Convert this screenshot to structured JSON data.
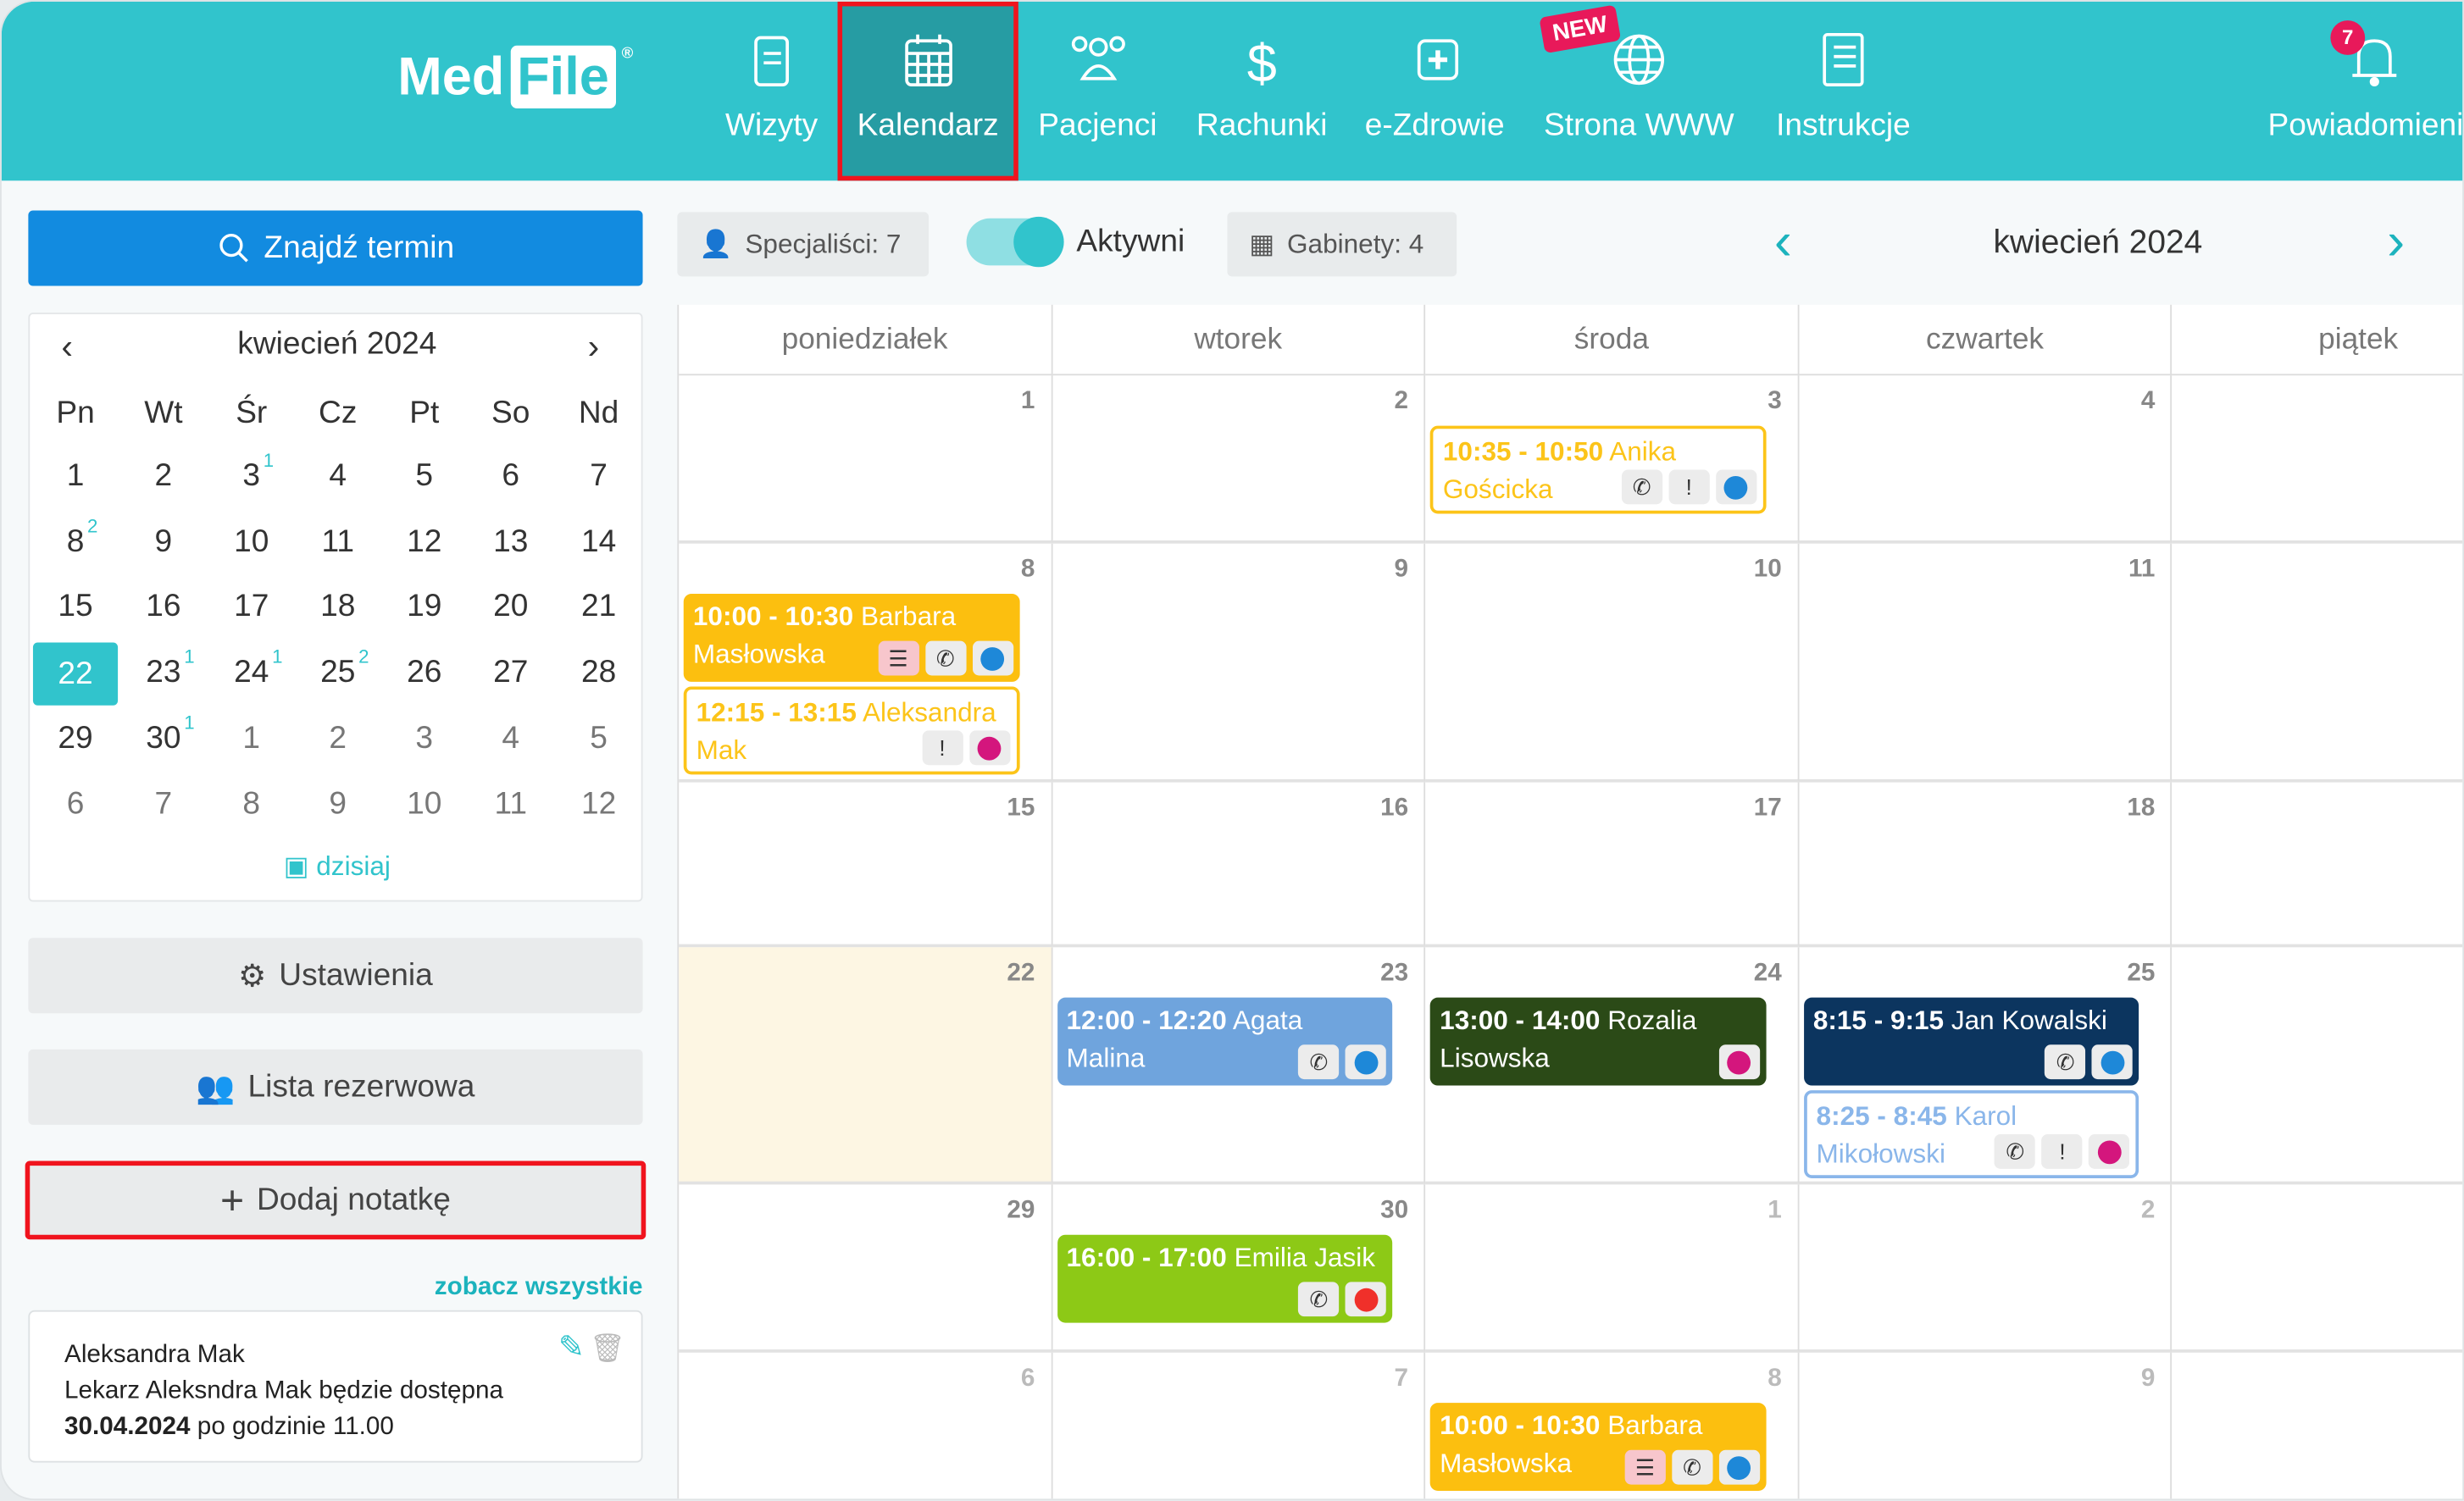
{
  "header": {
    "logo": {
      "text_a": "Med",
      "text_b": "File",
      "reg": "®"
    },
    "nav": [
      {
        "label": "Wizyty",
        "icon": "clipboard-icon",
        "active": false
      },
      {
        "label": "Kalendarz",
        "icon": "calendar-icon",
        "active": true
      },
      {
        "label": "Pacjenci",
        "icon": "users-icon",
        "active": false
      },
      {
        "label": "Rachunki",
        "icon": "dollar-icon",
        "active": false
      },
      {
        "label": "e-Zdrowie",
        "icon": "medical-plus-icon",
        "active": false
      },
      {
        "label": "Strona WWW",
        "icon": "globe-icon",
        "active": false
      },
      {
        "label": "Instrukcje",
        "icon": "book-icon",
        "active": false
      },
      {
        "label": "Powiadomienia",
        "icon": "bell-icon",
        "active": false
      }
    ],
    "new_badge": "NEW",
    "notification_count": "7"
  },
  "sidebar": {
    "find_button": "Znajdź termin",
    "mini_calendar": {
      "title": "kwiecień 2024",
      "weekdays": [
        "Pn",
        "Wt",
        "Śr",
        "Cz",
        "Pt",
        "So",
        "Nd"
      ],
      "weeks": [
        [
          {
            "d": "1"
          },
          {
            "d": "2"
          },
          {
            "d": "3",
            "c": "1"
          },
          {
            "d": "4"
          },
          {
            "d": "5"
          },
          {
            "d": "6"
          },
          {
            "d": "7"
          }
        ],
        [
          {
            "d": "8",
            "c": "2"
          },
          {
            "d": "9"
          },
          {
            "d": "10"
          },
          {
            "d": "11"
          },
          {
            "d": "12"
          },
          {
            "d": "13"
          },
          {
            "d": "14"
          }
        ],
        [
          {
            "d": "15"
          },
          {
            "d": "16"
          },
          {
            "d": "17"
          },
          {
            "d": "18"
          },
          {
            "d": "19"
          },
          {
            "d": "20"
          },
          {
            "d": "21"
          }
        ],
        [
          {
            "d": "22",
            "today": true
          },
          {
            "d": "23",
            "c": "1"
          },
          {
            "d": "24",
            "c": "1"
          },
          {
            "d": "25",
            "c": "2"
          },
          {
            "d": "26"
          },
          {
            "d": "27"
          },
          {
            "d": "28"
          }
        ],
        [
          {
            "d": "29"
          },
          {
            "d": "30",
            "c": "1"
          },
          {
            "d": "1",
            "o": true
          },
          {
            "d": "2",
            "o": true
          },
          {
            "d": "3",
            "o": true
          },
          {
            "d": "4",
            "o": true
          },
          {
            "d": "5",
            "o": true
          }
        ],
        [
          {
            "d": "6",
            "o": true
          },
          {
            "d": "7",
            "o": true
          },
          {
            "d": "8",
            "o": true
          },
          {
            "d": "9",
            "o": true
          },
          {
            "d": "10",
            "o": true
          },
          {
            "d": "11",
            "o": true
          },
          {
            "d": "12",
            "o": true
          }
        ]
      ],
      "today_link": "dzisiaj"
    },
    "settings_button": "Ustawienia",
    "waitlist_button": "Lista rezerwowa",
    "add_note_button": "Dodaj notatkę",
    "see_all_link": "zobacz wszystkie",
    "note": {
      "author": "Aleksandra Mak",
      "text": "Lekarz Aleksndra Mak będzie dostępna",
      "date": "30.04.2024",
      "text_end": "po godzinie 11.00"
    }
  },
  "toolbar": {
    "specialists": "Specjaliści: 7",
    "toggle_label": "Aktywni",
    "toggle_on": true,
    "rooms": "Gabinety: 4",
    "month": "kwiecień 2024"
  },
  "calendar": {
    "weekdays": [
      "poniedziałek",
      "wtorek",
      "środa",
      "czwartek",
      "piątek"
    ],
    "weeks": [
      {
        "days": [
          {
            "d": "1"
          },
          {
            "d": "2"
          },
          {
            "d": "3"
          },
          {
            "d": "4"
          },
          {
            "d": ""
          }
        ]
      },
      {
        "days": [
          {
            "d": "8"
          },
          {
            "d": "9"
          },
          {
            "d": "10"
          },
          {
            "d": "11"
          },
          {
            "d": ""
          }
        ]
      },
      {
        "days": [
          {
            "d": "15"
          },
          {
            "d": "16"
          },
          {
            "d": "17"
          },
          {
            "d": "18"
          },
          {
            "d": ""
          }
        ]
      },
      {
        "days": [
          {
            "d": "22",
            "today": true
          },
          {
            "d": "23"
          },
          {
            "d": "24"
          },
          {
            "d": "25"
          },
          {
            "d": ""
          }
        ]
      },
      {
        "days": [
          {
            "d": "29"
          },
          {
            "d": "30"
          },
          {
            "d": "1",
            "o": true
          },
          {
            "d": "2",
            "o": true
          },
          {
            "d": ""
          }
        ]
      },
      {
        "days": [
          {
            "d": "6",
            "o": true
          },
          {
            "d": "7",
            "o": true
          },
          {
            "d": "8",
            "o": true
          },
          {
            "d": "9",
            "o": true
          },
          {
            "d": ""
          }
        ]
      }
    ],
    "events": [
      {
        "week": 0,
        "day": 2,
        "slot": 0,
        "time": "10:35 - 10:50",
        "name": "Anika Gościcka",
        "style": "outline",
        "color": "#fcc419",
        "icons": [
          "phone",
          "alert",
          "dot:#1e88d8"
        ]
      },
      {
        "week": 1,
        "day": 0,
        "slot": 0,
        "time": "10:00 - 10:30",
        "name": "Barbara Masłowska",
        "style": "fill",
        "color": "#fcbf0f",
        "icons": [
          "list",
          "phone",
          "dot:#1e88d8"
        ]
      },
      {
        "week": 1,
        "day": 0,
        "slot": 1,
        "time": "12:15 - 13:15",
        "name": "Aleksandra Mak",
        "style": "outline",
        "color": "#fcc419",
        "icons": [
          "alert",
          "dot:#d4167d"
        ]
      },
      {
        "week": 3,
        "day": 1,
        "slot": 0,
        "time": "12:00 - 12:20",
        "name": "Agata Malina",
        "style": "fill",
        "color": "#6fa4dd",
        "icons": [
          "phone",
          "dot:#1e88d8"
        ]
      },
      {
        "week": 3,
        "day": 2,
        "slot": 0,
        "time": "13:00 - 14:00",
        "name": "Rozalia Lisowska",
        "style": "fill",
        "color": "#2b4a17",
        "icons": [
          "dot:#d4167d"
        ]
      },
      {
        "week": 3,
        "day": 3,
        "slot": 0,
        "time": "8:15 - 9:15",
        "name": "Jan Kowalski",
        "style": "fill",
        "color": "#0c355f",
        "icons": [
          "phone",
          "dot:#1e88d8"
        ]
      },
      {
        "week": 3,
        "day": 3,
        "slot": 1,
        "time": "8:25 - 8:45",
        "name": "Karol Mikołowski",
        "style": "outline",
        "color": "#8ab6ea",
        "icons": [
          "phone",
          "alert",
          "dot:#d4167d"
        ]
      },
      {
        "week": 4,
        "day": 1,
        "slot": 0,
        "time": "16:00 - 17:00",
        "name": "Emilia Jasik",
        "style": "fill",
        "color": "#8dc916",
        "icons": [
          "phone",
          "dot:#f0302a"
        ]
      },
      {
        "week": 5,
        "day": 2,
        "slot": 0,
        "time": "10:00 - 10:30",
        "name": "Barbara Masłowska",
        "style": "fill",
        "color": "#fcbf0f",
        "icons": [
          "list",
          "phone",
          "dot:#1e88d8"
        ]
      }
    ]
  }
}
